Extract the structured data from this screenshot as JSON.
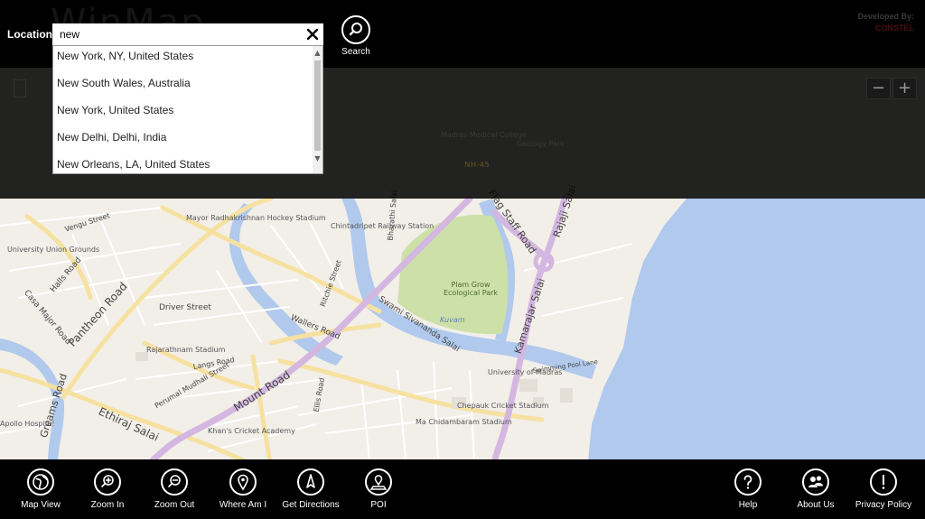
{
  "topbar": {
    "app_title": "WinMap",
    "location_label": "Location:",
    "location_value": "new",
    "search_label": "Search",
    "developer_label": "Developed By:",
    "developer_name": "CONSTEL"
  },
  "suggestions": [
    "New York, NY, United States",
    "New South Wales, Australia",
    "New York, United States",
    "New Delhi, Delhi, India",
    "New Orleans, LA, United States"
  ],
  "map": {
    "zoom_in_label": "+",
    "zoom_out_label": "−",
    "labels": {
      "chintadripet": "Chintadripet Railway Station",
      "mayor": "Mayor Radhakrishnan Hockey Stadium",
      "university_grounds": "University Union Grounds",
      "plam_grow": "Plam Grow Ecological Park",
      "kuvam": "Kuvam",
      "rajarathnam": "Rajarathnam Stadium",
      "university_madras": "University of Madras",
      "chepauk": "Chepauk Cricket Stadium",
      "chidambaram": "Ma Chidambaram Stadium",
      "khans": "Khan's Cricket Academy",
      "apollo": "Apollo Hospital",
      "maduras": "Madras Medical College",
      "geology": "Geology Park",
      "nh": "NH-45"
    },
    "roads": {
      "flag_staff": "Flag Staff Road",
      "rajaji": "Rajaji Salai",
      "swami": "Swami Sivananda Salai",
      "kamarajar": "Kamarajar Salai",
      "mount": "Mount Road",
      "ethiraj": "Ethiraj Salai",
      "pantheon": "Pantheon Road",
      "greams": "Greams Road",
      "casa_major": "Casa Major Road",
      "halls": "Halls Road",
      "vengu": "Vengu Street",
      "driver": "Driver Street",
      "wallers": "Wallers Road",
      "langs": "Langs Road",
      "perumal": "Perumal Mudhali Street",
      "ellis": "Ellis Road",
      "ritchie": "Ritchie Street",
      "bharathi": "Bharathi Salai",
      "swimming_pool": "Swimming Pool Lane"
    }
  },
  "appbar": {
    "left": [
      {
        "label": "Map View",
        "icon": "globe-icon"
      },
      {
        "label": "Zoom In",
        "icon": "zoom-in-icon"
      },
      {
        "label": "Zoom Out",
        "icon": "zoom-out-icon"
      },
      {
        "label": "Where Am I",
        "icon": "location-pin-icon"
      },
      {
        "label": "Get Directions",
        "icon": "directions-icon"
      },
      {
        "label": "POI",
        "icon": "poi-icon"
      }
    ],
    "right": [
      {
        "label": "Help",
        "icon": "help-icon"
      },
      {
        "label": "About Us",
        "icon": "people-icon"
      },
      {
        "label": "Privacy Policy",
        "icon": "exclamation-icon"
      }
    ]
  },
  "colors": {
    "land": "#f2efe9",
    "water": "#b0c9ec",
    "park": "#cde0a8",
    "major_road": "#d4b7e0",
    "arterial_road": "#f7e1a1",
    "minor_road": "#ffffff"
  }
}
